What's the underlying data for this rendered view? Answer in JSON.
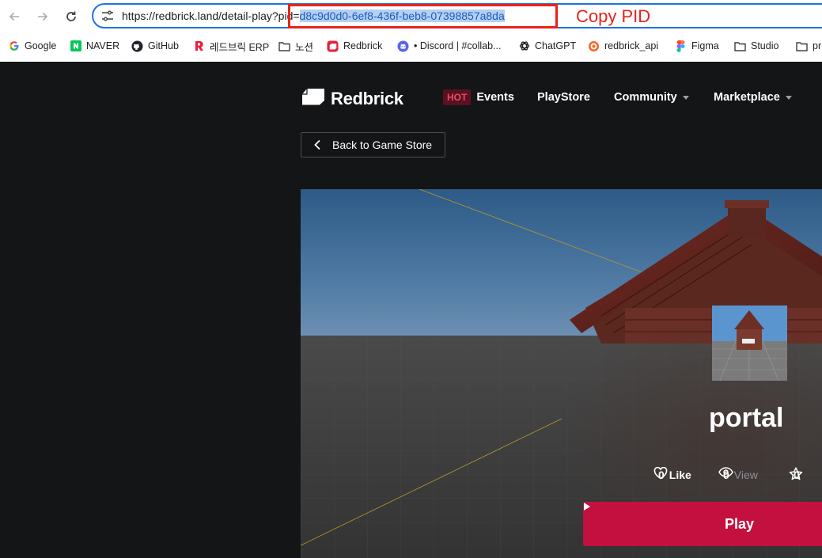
{
  "browser": {
    "url_prefix": "https://redbrick.land/detail-play?",
    "url_pid_key": "pid=",
    "url_pid_value": "d8c9d0d0-6ef8-436f-beb8-07398857a8da",
    "annotation": "Copy PID",
    "bookmarks": [
      {
        "label": "Google",
        "icon": "google-icon"
      },
      {
        "label": "NAVER",
        "icon": "naver-icon"
      },
      {
        "label": "GitHub",
        "icon": "github-icon"
      },
      {
        "label": "레드브릭 ERP",
        "icon": "redbrick-r-icon"
      },
      {
        "label": "노션",
        "icon": "folder-icon"
      },
      {
        "label": "Redbrick",
        "icon": "redbrick-icon"
      },
      {
        "label": "• Discord | #collab...",
        "icon": "discord-icon"
      },
      {
        "label": "ChatGPT",
        "icon": "chatgpt-icon"
      },
      {
        "label": "redbrick_api",
        "icon": "api-icon"
      },
      {
        "label": "Figma",
        "icon": "figma-icon"
      },
      {
        "label": "Studio",
        "icon": "folder-icon"
      },
      {
        "label": "pr",
        "icon": "folder-icon"
      }
    ]
  },
  "site": {
    "logo": "Redbrick",
    "nav": {
      "hot_badge": "HOT",
      "events": "Events",
      "playstore": "PlayStore",
      "community": "Community",
      "marketplace": "Marketplace"
    },
    "back_label": "Back to Game Store",
    "game": {
      "title": "portal",
      "likes": "0",
      "like_label": "Like",
      "views": "0",
      "view_label": "View",
      "stars": "0",
      "play_label": "Play"
    }
  },
  "colors": {
    "accent": "#c4103f",
    "annotation": "#e8231a",
    "background": "#141517",
    "omnibox_border": "#1a73e8"
  }
}
